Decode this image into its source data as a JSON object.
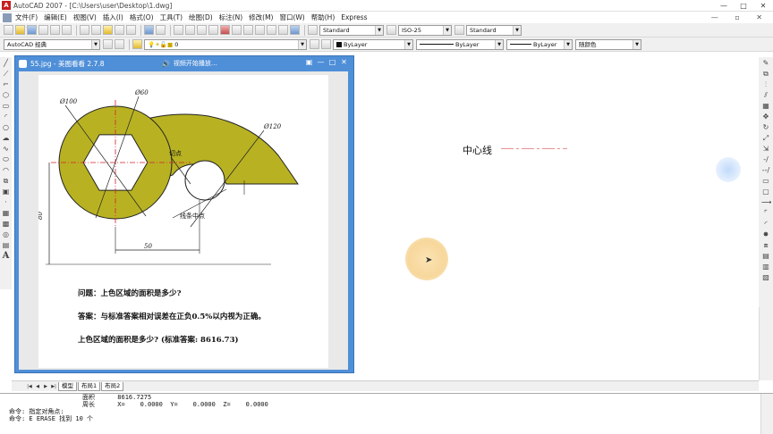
{
  "window": {
    "title": "AutoCAD 2007 - [C:\\Users\\user\\Desktop\\1.dwg]",
    "app_icon": "A",
    "controls": [
      "—",
      "□",
      "✕"
    ],
    "mdi_controls": "— ▫ ✕"
  },
  "menu": [
    "文件(F)",
    "编辑(E)",
    "视图(V)",
    "插入(I)",
    "格式(O)",
    "工具(T)",
    "绘图(D)",
    "标注(N)",
    "修改(M)",
    "窗口(W)",
    "帮助(H)",
    "Express"
  ],
  "toolbar1": {
    "text_style": "Standard",
    "dim_style": "ISO-25",
    "table_style": "Standard"
  },
  "toolbar2": {
    "workspace": "AutoCAD 经典",
    "layer": "0",
    "color": "ByLayer",
    "linetype": "ByLayer",
    "lineweight": "ByLayer",
    "plotstyle": "随颜色"
  },
  "viewer": {
    "name": "55.jpg - 美图看看 2.7.8",
    "notice": "视频开始播放…  ",
    "controls": [
      "▣",
      "—",
      "□",
      "✕"
    ]
  },
  "drawing_labels": {
    "d100": "Ø100",
    "d60": "Ø60",
    "d120": "Ø120",
    "tangent": "切点",
    "midpoint": "线条中点",
    "dim50": "50",
    "dim_left": "80"
  },
  "notes": {
    "line1": "问题：上色区域的面积是多少?",
    "line2": "答案：与标准答案相对误差在正负0.5%以内视为正确。",
    "line3": "上色区域的面积是多少?  (标准答案: 8616.73)"
  },
  "canvas_annotation": {
    "label": "中心线"
  },
  "tabs": {
    "nav": [
      "|◀",
      "◀",
      "▶",
      "▶|"
    ],
    "items": [
      "模型",
      "布局1",
      "布局2"
    ]
  },
  "command_lines": [
    {
      "text": "面积      8616.7275",
      "indent": true
    },
    {
      "text": "周长      X=    0.0000  Y=    0.0000  Z=    0.0000",
      "indent": true
    },
    {
      "text": "命令: 指定对角点:",
      "indent": false
    },
    {
      "text": "命令: E ERASE 找到 10 个",
      "indent": false
    }
  ],
  "colors": {
    "fill": "#b8b223",
    "viewer_title": "#4f8fd8",
    "centerline": "#d2202a",
    "cursor_halo": "#f7d79b"
  }
}
